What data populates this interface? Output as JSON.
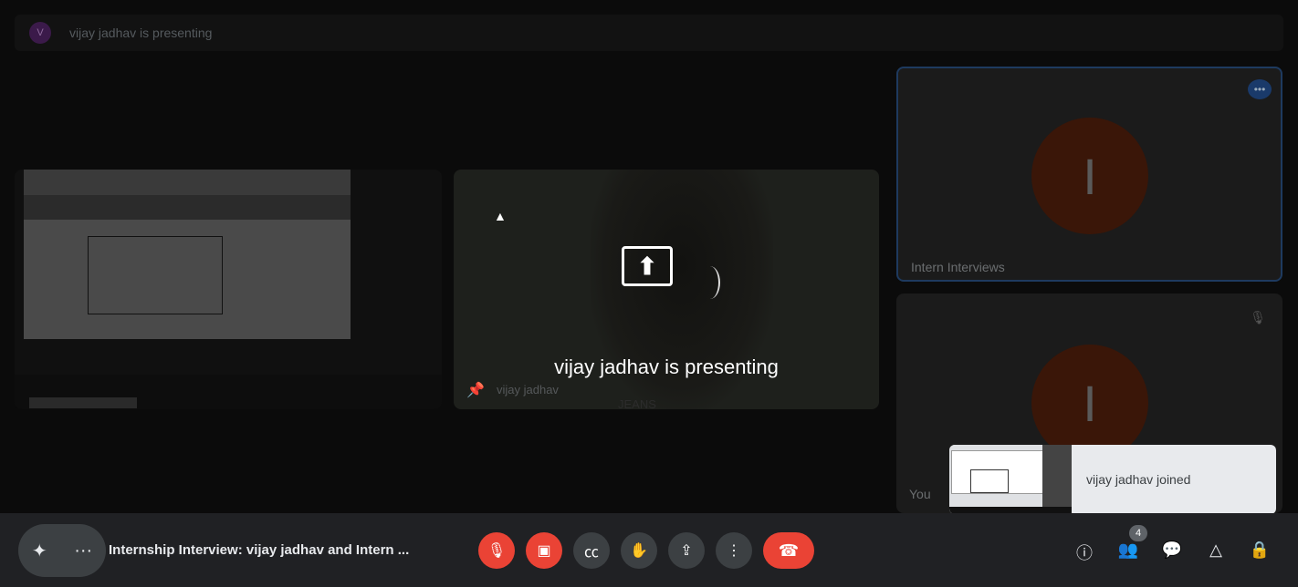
{
  "banner": {
    "avatar_initial": "V",
    "text": "vijay jadhav is presenting"
  },
  "tiles": {
    "camera": {
      "overlay_text": "vijay jadhav is presenting",
      "name": "vijay jadhav",
      "shirt_logo": "JEANS"
    },
    "intern": {
      "initial": "I",
      "name": "Intern Interviews",
      "more_label": "•••"
    },
    "you": {
      "initial": "I",
      "name": "You"
    }
  },
  "toast": {
    "text": "vijay jadhav joined"
  },
  "bottom_bar": {
    "meeting_title": "Internship Interview: vijay jadhav and Intern ...",
    "people_count": "4"
  },
  "colors": {
    "end_call": "#ea4335",
    "control_bg": "#3c4043",
    "bar_bg": "#202124"
  }
}
